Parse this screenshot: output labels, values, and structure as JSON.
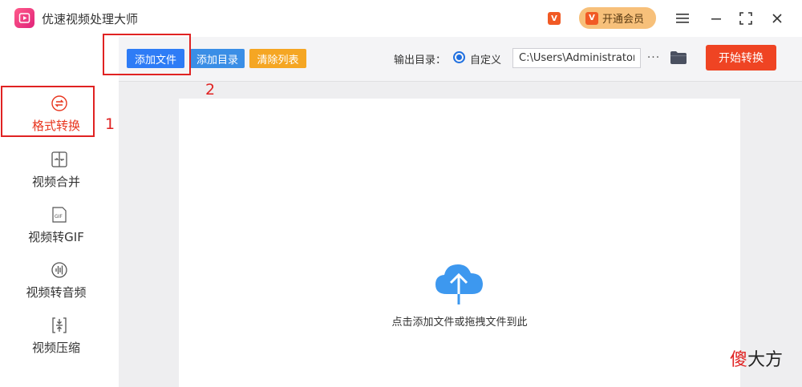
{
  "app": {
    "title": "优速视频处理大师"
  },
  "titlebar": {
    "vip_small_badge": "V",
    "vip_button_badge": "V",
    "vip_button_label": "开通会员",
    "icons": [
      "menu-icon",
      "minimize-icon",
      "fullscreen-icon",
      "close-icon"
    ]
  },
  "sidebar": {
    "items": [
      {
        "label": "格式转换",
        "icon": "format-convert-icon",
        "active": true
      },
      {
        "label": "视频合并",
        "icon": "video-merge-icon",
        "active": false
      },
      {
        "label": "视频转GIF",
        "icon": "gif-icon",
        "active": false
      },
      {
        "label": "视频转音频",
        "icon": "audio-icon",
        "active": false
      },
      {
        "label": "视频压缩",
        "icon": "compress-icon",
        "active": false
      }
    ]
  },
  "toolbar": {
    "add_file_label": "添加文件",
    "add_folder_label": "添加目录",
    "clear_list_label": "清除列表",
    "output_dir_label": "输出目录：",
    "custom_label": "自定义",
    "path_value": "C:\\Users\\Administrator\\",
    "more_label": "···",
    "start_label": "开始转换"
  },
  "dropzone": {
    "hint": "点击添加文件或拖拽文件到此"
  },
  "annotations": {
    "step1": "1",
    "step2": "2"
  },
  "watermark": {
    "first": "傻",
    "rest": "大方"
  },
  "colors": {
    "accent_red": "#ef4423",
    "add_file_blue": "#2e7cf6",
    "add_folder_blue": "#3a8ee6",
    "clear_orange": "#f5a623",
    "vip_orange": "#f7c07a",
    "annotation_red": "#e02222"
  }
}
